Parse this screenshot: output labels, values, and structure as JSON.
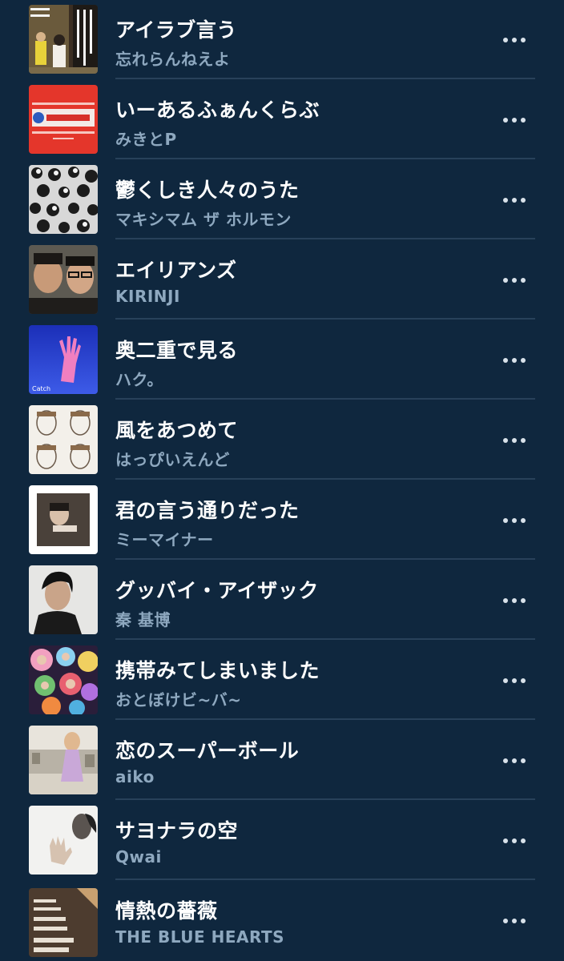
{
  "songs": [
    {
      "title": "アイラブ言う",
      "artist": "忘れらんねえよ",
      "art_icon": "album-art-ilove"
    },
    {
      "title": "いーあるふぁんくらぶ",
      "artist": "みきとP",
      "art_icon": "album-art-red"
    },
    {
      "title": "鬱くしき人々のうた",
      "artist": "マキシマム ザ ホルモン",
      "art_icon": "album-art-pattern"
    },
    {
      "title": "エイリアンズ",
      "artist": "KIRINJI",
      "art_icon": "album-art-duo"
    },
    {
      "title": "奥二重で見る",
      "artist": "ハク。",
      "art_icon": "album-art-catch",
      "art_text": "Catch"
    },
    {
      "title": "風をあつめて",
      "artist": "はっぴいえんど",
      "art_icon": "album-art-faces"
    },
    {
      "title": "君の言う通りだった",
      "artist": "ミーマイナー",
      "art_icon": "album-art-photo-frame"
    },
    {
      "title": "グッバイ・アイザック",
      "artist": "秦 基博",
      "art_icon": "album-art-portrait"
    },
    {
      "title": "携帯みてしまいました",
      "artist": "おとぼけビ~バ~",
      "art_icon": "album-art-collage"
    },
    {
      "title": "恋のスーパーボール",
      "artist": "aiko",
      "art_icon": "album-art-rooftop"
    },
    {
      "title": "サヨナラの空",
      "artist": "Qwai",
      "art_icon": "album-art-hand"
    },
    {
      "title": "情熱の薔薇",
      "artist": "THE BLUE HEARTS",
      "art_icon": "album-art-blue-hearts"
    }
  ],
  "more_icon": "more-horizontal-icon",
  "colors": {
    "background": "#0f273e",
    "title": "#ffffff",
    "artist": "#8ea8bf",
    "separator": "#28415a",
    "dots": "#d9e2ea"
  }
}
